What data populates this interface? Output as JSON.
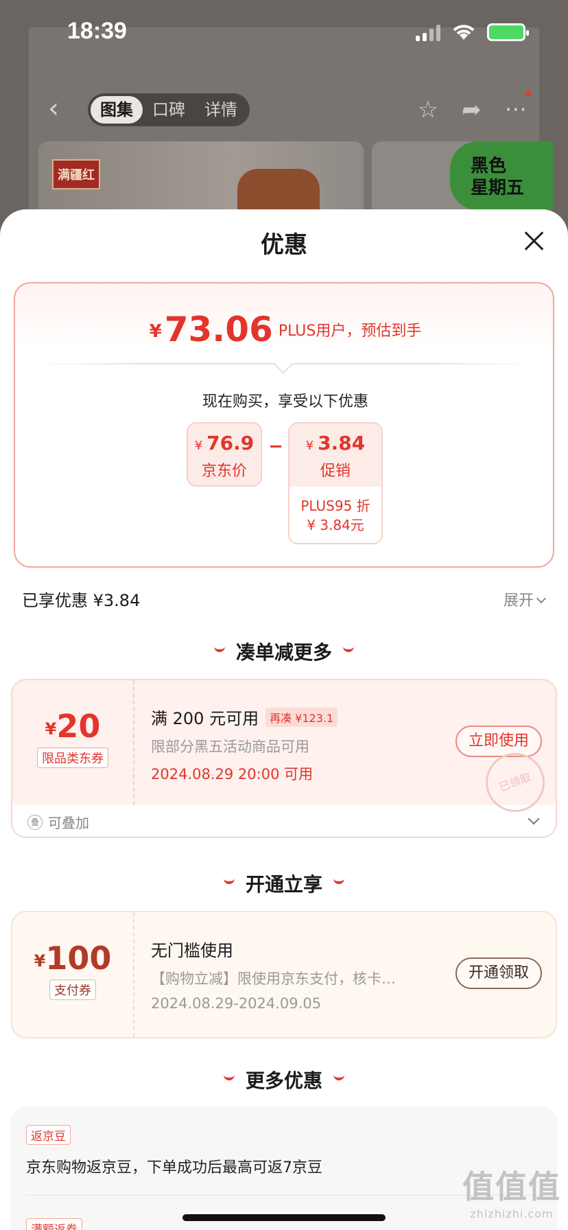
{
  "status_bar": {
    "time": "18:39"
  },
  "background": {
    "tabs": [
      "图集",
      "口碑",
      "详情"
    ],
    "active_tab": 0,
    "brand_logo_text": "满疆红",
    "badge_line1": "黑色",
    "badge_line2": "星期五"
  },
  "sheet": {
    "title": "优惠",
    "summary": {
      "currency": "¥",
      "price": "73.06",
      "note": "PLUS用户，预估到手",
      "subtitle": "现在购买，享受以下优惠",
      "jd_price": {
        "currency": "¥",
        "amount": "76.9",
        "label": "京东价"
      },
      "promo": {
        "currency": "¥",
        "amount": "3.84",
        "label": "促销",
        "detail_line1": "PLUS95 折",
        "detail_line2": "¥ 3.84元"
      }
    },
    "enjoyed_text": "已享优惠 ¥3.84",
    "expand_label": "展开",
    "section_1": "凑单减更多",
    "coupon_1": {
      "currency": "¥",
      "amount": "20",
      "tag": "限品类东券",
      "title": "满 200 元可用",
      "chip": "再凑 ¥123.1",
      "desc": "限部分黑五活动商品可用",
      "date": "2024.08.29 20:00 可用",
      "button": "立即使用",
      "stamp": "已领取",
      "foot_icon": "叠",
      "foot_text": "可叠加"
    },
    "section_2": "开通立享",
    "coupon_2": {
      "currency": "¥",
      "amount": "100",
      "tag": "支付券",
      "title": "无门槛使用",
      "desc": "【购物立减】限使用京东支付，核卡…",
      "date": "2024.08.29-2024.09.05",
      "button": "开通领取"
    },
    "section_3": "更多优惠",
    "more": {
      "tag_1": "返京豆",
      "text_1": "京东购物返京豆，下单成功后最高可返7京豆",
      "tag_2": "满额返券"
    }
  },
  "watermark": {
    "big": "值值值",
    "small": "zhizhizhi.com"
  },
  "colors": {
    "accent": "#e2352b",
    "sheet_bg": "#ffffff",
    "coupon_bg": "#fef1ee"
  }
}
